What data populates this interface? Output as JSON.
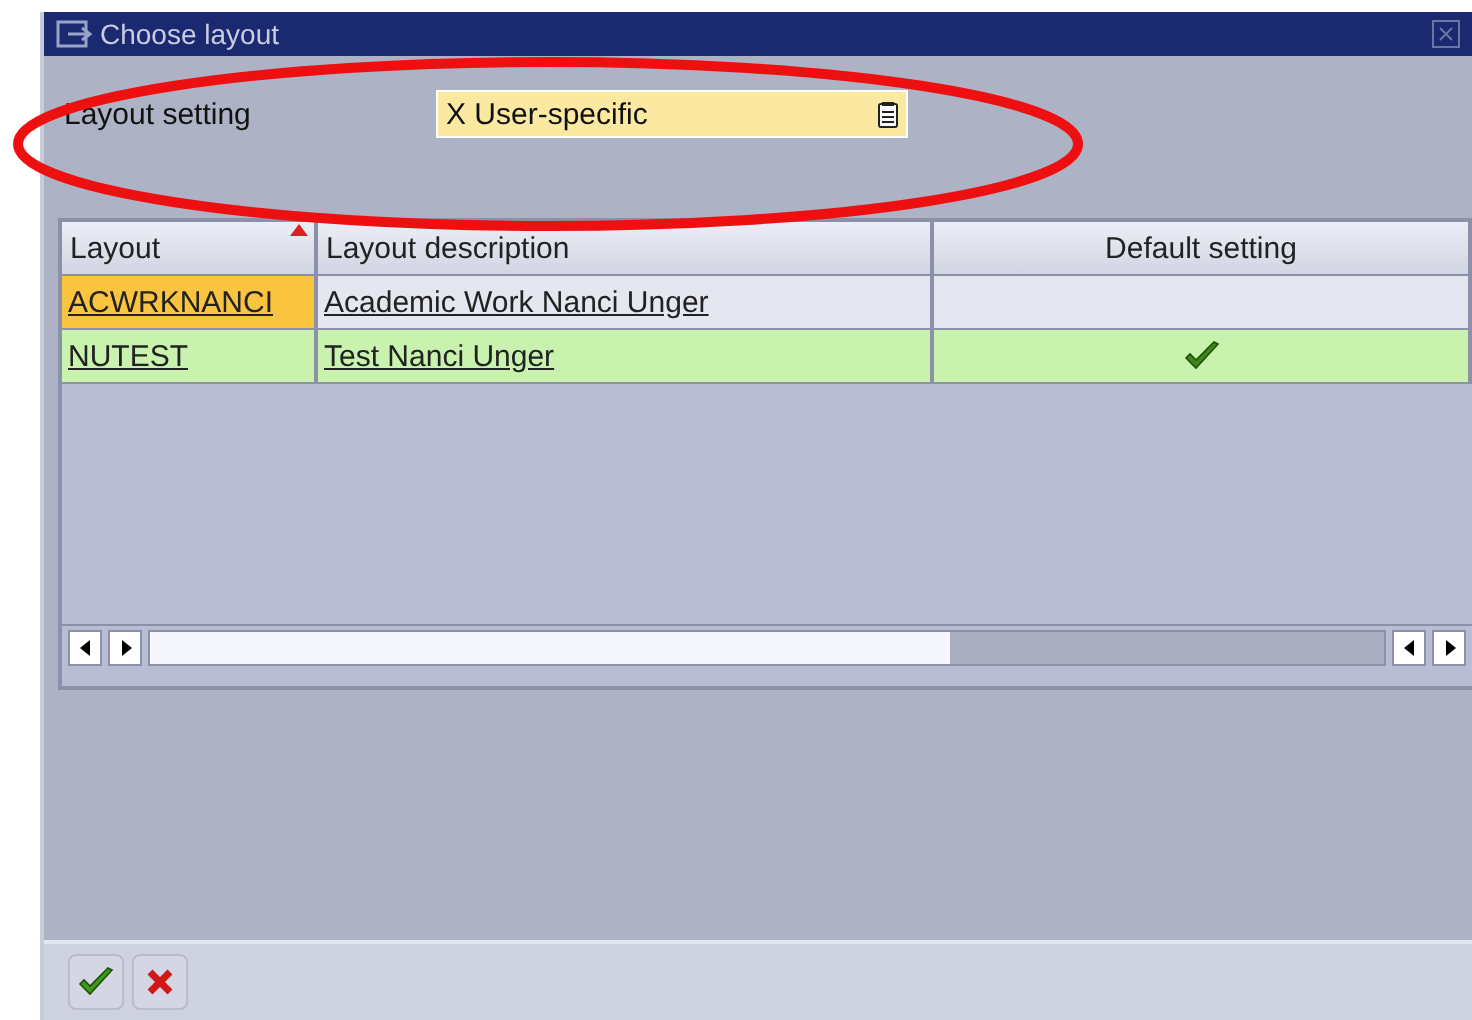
{
  "window": {
    "title": "Choose layout"
  },
  "layout_setting": {
    "label": "Layout setting",
    "value": "X User-specific"
  },
  "table": {
    "columns": [
      {
        "label": "Layout",
        "sorted": true
      },
      {
        "label": "Layout description",
        "sorted": false
      },
      {
        "label": "Default setting",
        "sorted": false
      }
    ],
    "rows": [
      {
        "layout": "ACWRKNANCI",
        "description": "Academic Work Nanci Unger",
        "current": true,
        "default": false
      },
      {
        "layout": "NUTEST",
        "description": "Test Nanci Unger",
        "current": false,
        "default": true
      }
    ]
  },
  "buttons": [
    {
      "kind": "confirm"
    },
    {
      "kind": "cancel"
    }
  ]
}
